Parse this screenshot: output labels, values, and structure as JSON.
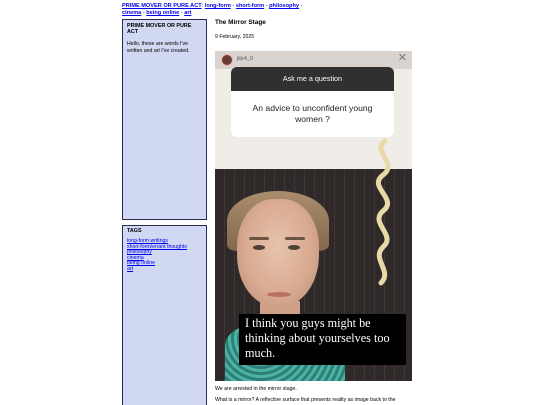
{
  "nav": {
    "site_title": "PRIME MOVER OR PURE ACT",
    "links": [
      "long-form",
      "short-form",
      "philosophy",
      "cinema",
      "being online",
      "art"
    ]
  },
  "about": {
    "title": "PRIME MOVER OR PURE ACT",
    "text": "Hello, these are words I've written and art I've created."
  },
  "tags": {
    "title": "TAGS",
    "items": [
      "long-form writings",
      "short-form/errant thoughts",
      "philosophy",
      "cinema",
      "being online",
      "art"
    ]
  },
  "post": {
    "title": "The Mirror Stage",
    "date": "9 February, 2025",
    "story": {
      "username": "jkk4_0",
      "question_header": "Ask me a question",
      "question": "An advice to unconfident young women ?",
      "caption": "I think you guys might be thinking about yourselves too much."
    },
    "paragraph_1": "We are arrested in the mirror stage.",
    "paragraph_2": "What is a mirror? A reflective surface that presents reality as image back to the"
  }
}
